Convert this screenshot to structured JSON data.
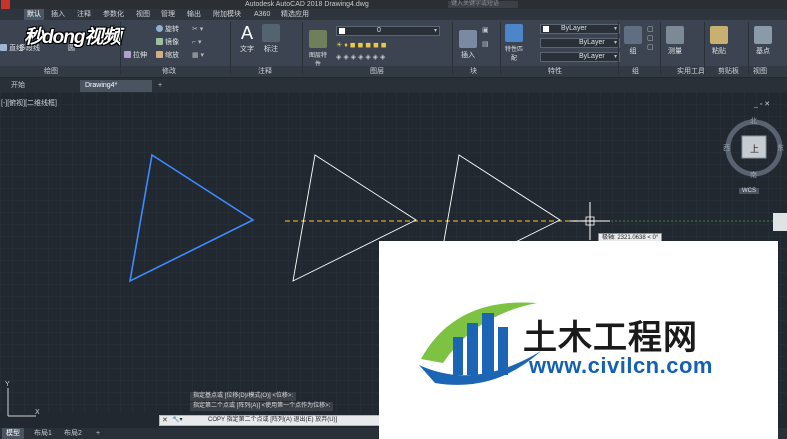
{
  "window": {
    "title": "Autodesk AutoCAD 2018    Drawing4.dwg",
    "search_placeholder": "键入关键字或短语"
  },
  "ribbon_tabs": [
    "默认",
    "插入",
    "注释",
    "参数化",
    "视图",
    "管理",
    "输出",
    "附加模块",
    "A360",
    "精选应用"
  ],
  "ribbon": {
    "draw_tools": [
      {
        "label": "直线",
        "icon": "line-icon"
      },
      {
        "label": "多段线",
        "icon": "polyline-icon"
      },
      {
        "label": "圆",
        "icon": "circle-icon"
      },
      {
        "label": "圆弧",
        "icon": "arc-icon"
      }
    ],
    "modify_tools": [
      {
        "label": "移动",
        "icon": "move-icon"
      },
      {
        "label": "旋转",
        "icon": "rotate-icon"
      },
      {
        "label": "复制",
        "icon": "copy-icon"
      },
      {
        "label": "镜像",
        "icon": "mirror-icon"
      },
      {
        "label": "拉伸",
        "icon": "stretch-icon"
      },
      {
        "label": "缩放",
        "icon": "scale-icon"
      }
    ],
    "annotation_tools": [
      {
        "label": "文字",
        "icon": "text-icon"
      },
      {
        "label": "标注",
        "icon": "dimension-icon"
      }
    ],
    "layer_tools": [
      {
        "label": "图层特性",
        "icon": "layer-properties-icon"
      }
    ],
    "layer_dropdown_value": "0",
    "block_tools": [
      {
        "label": "插入",
        "icon": "insert-block-icon"
      }
    ],
    "properties_tools": [
      {
        "label": "特性匹配",
        "icon": "match-properties-icon"
      }
    ],
    "bylayer_color": "ByLayer",
    "bylayer_linetype": "ByLayer",
    "bylayer_lineweight": "ByLayer",
    "group_tools": [
      {
        "label": "组",
        "icon": "group-icon"
      }
    ],
    "utility_tools": [
      {
        "label": "测量",
        "icon": "measure-icon"
      }
    ],
    "clipboard_tools": [
      {
        "label": "粘贴",
        "icon": "paste-icon"
      }
    ],
    "base_tools": [
      {
        "label": "基点",
        "icon": "base-point-icon"
      }
    ],
    "panel_titles": [
      "绘图",
      "修改",
      "注释",
      "图层",
      "块",
      "特性",
      "组",
      "实用工具",
      "剪贴板",
      "视图"
    ]
  },
  "brand_watermark": "秒dong视频",
  "file_tabs": [
    {
      "label": "开始",
      "active": false
    },
    {
      "label": "Drawing4*",
      "active": true
    }
  ],
  "viewport_label": "[-][俯视][二维线框]",
  "viewcube": {
    "north": "北",
    "south": "南",
    "east": "东",
    "west": "西",
    "face": "上",
    "wcs": "WCS"
  },
  "tooltip_text": "极轴: 2321.0638 < 0°",
  "command_history": [
    "指定基点或 [位移(D)/模式(O)] <位移>:",
    "指定第二个点或 [阵列(A)] <使用第一个点作为位移>:"
  ],
  "command_line": "COPY 指定第二个点或 [阵列(A) 退出(E) 放弃(U)]",
  "layout_tabs": [
    {
      "label": "模型",
      "active": true
    },
    {
      "label": "布局1",
      "active": false
    },
    {
      "label": "布局2",
      "active": false
    }
  ],
  "overlay": {
    "cn_text": "土木工程网",
    "url_text": "www.civilcn.com"
  },
  "colors": {
    "canvas_bg": "#212830",
    "selected_triangle": "#3d8bff",
    "copy_triangle": "#ffffff",
    "tracking_line": "#e0a030",
    "polar_line": "#3aa33a"
  },
  "ucs": {
    "x_label": "X",
    "y_label": "Y"
  }
}
